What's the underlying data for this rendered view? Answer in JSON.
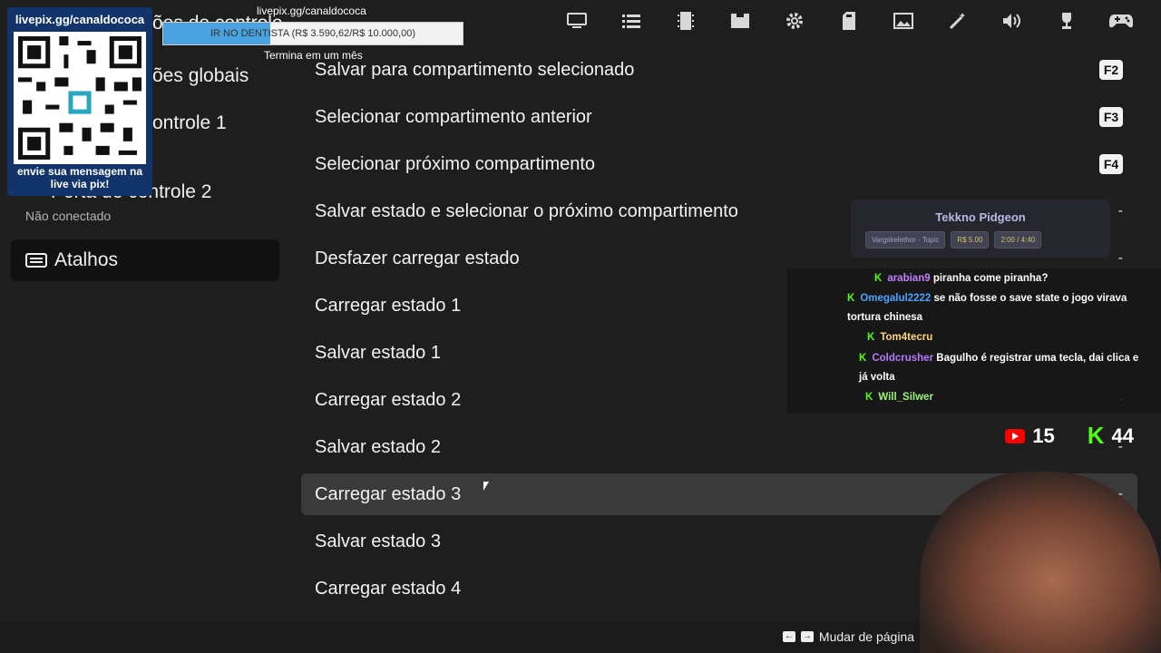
{
  "topbar": {
    "icons": [
      "monitor-icon",
      "list-icon",
      "chip-icon",
      "controller-port-icon",
      "gear-icon",
      "sd-card-icon",
      "image-icon",
      "magic-wand-icon",
      "volume-icon",
      "trophy-icon",
      "gamepad-icon"
    ]
  },
  "sidebar": {
    "item_1": "ões de controle",
    "item_2": "ões globais",
    "item_3": "ontrole 1",
    "item_4": "Porta de controle 2",
    "item_4_sub": "Não conectado",
    "active": "Atalhos"
  },
  "list": {
    "rows": [
      {
        "label": "Salvar para compartimento selecionado",
        "key": "F2"
      },
      {
        "label": "Selecionar compartimento anterior",
        "key": "F3"
      },
      {
        "label": "Selecionar próximo compartimento",
        "key": "F4"
      },
      {
        "label": "Salvar estado e selecionar o próximo compartimento",
        "key": "-"
      },
      {
        "label": "Desfazer carregar estado",
        "key": "-"
      },
      {
        "label": "Carregar estado 1",
        "key": "-"
      },
      {
        "label": "Salvar estado 1",
        "key": "-"
      },
      {
        "label": "Carregar estado 2",
        "key": "-"
      },
      {
        "label": "Salvar estado 2",
        "key": "-"
      },
      {
        "label": "Carregar estado 3",
        "key": "-"
      },
      {
        "label": "Salvar estado 3",
        "key": "-"
      },
      {
        "label": "Carregar estado 4",
        "key": ""
      }
    ]
  },
  "bottombar": {
    "pager_label": "Mudar de página"
  },
  "overlay": {
    "qr_top": "livepix.gg/canaldococa",
    "qr_bottom": "envie sua mensagem na live via pix!",
    "goal_url": "livepix.gg/canaldococa",
    "goal_text": "IR NO DENTISTA (R$ 3.590,62/R$ 10.000,00)",
    "goal_progress": 0.359,
    "goal_sub": "Termina em um mês",
    "tekkno_title": "Tekkno Pidgeon",
    "tekkno_tag_1": "Vargskelethor - Topic",
    "tekkno_tag_2": "R$ 5.00",
    "tekkno_tag_3": "2:00 / 4:40",
    "chat": [
      {
        "user": "arabian9",
        "color": "#c77dff",
        "text": "piranha come piranha?"
      },
      {
        "user": "Omegalul2222",
        "color": "#4aa3ff",
        "text": "se não fosse o save state o jogo virava tortura chinesa"
      },
      {
        "user": "Tom4tecru",
        "color": "#ffd37a",
        "text": ""
      },
      {
        "user": "Coldcrusher",
        "color": "#b57bff",
        "text": "Bagulho é registrar uma tecla, dai clica e já volta"
      },
      {
        "user": "Will_Silwer",
        "color": "#9ff27a",
        "text": ""
      }
    ],
    "youtube_count": "15",
    "kick_count": "44"
  }
}
